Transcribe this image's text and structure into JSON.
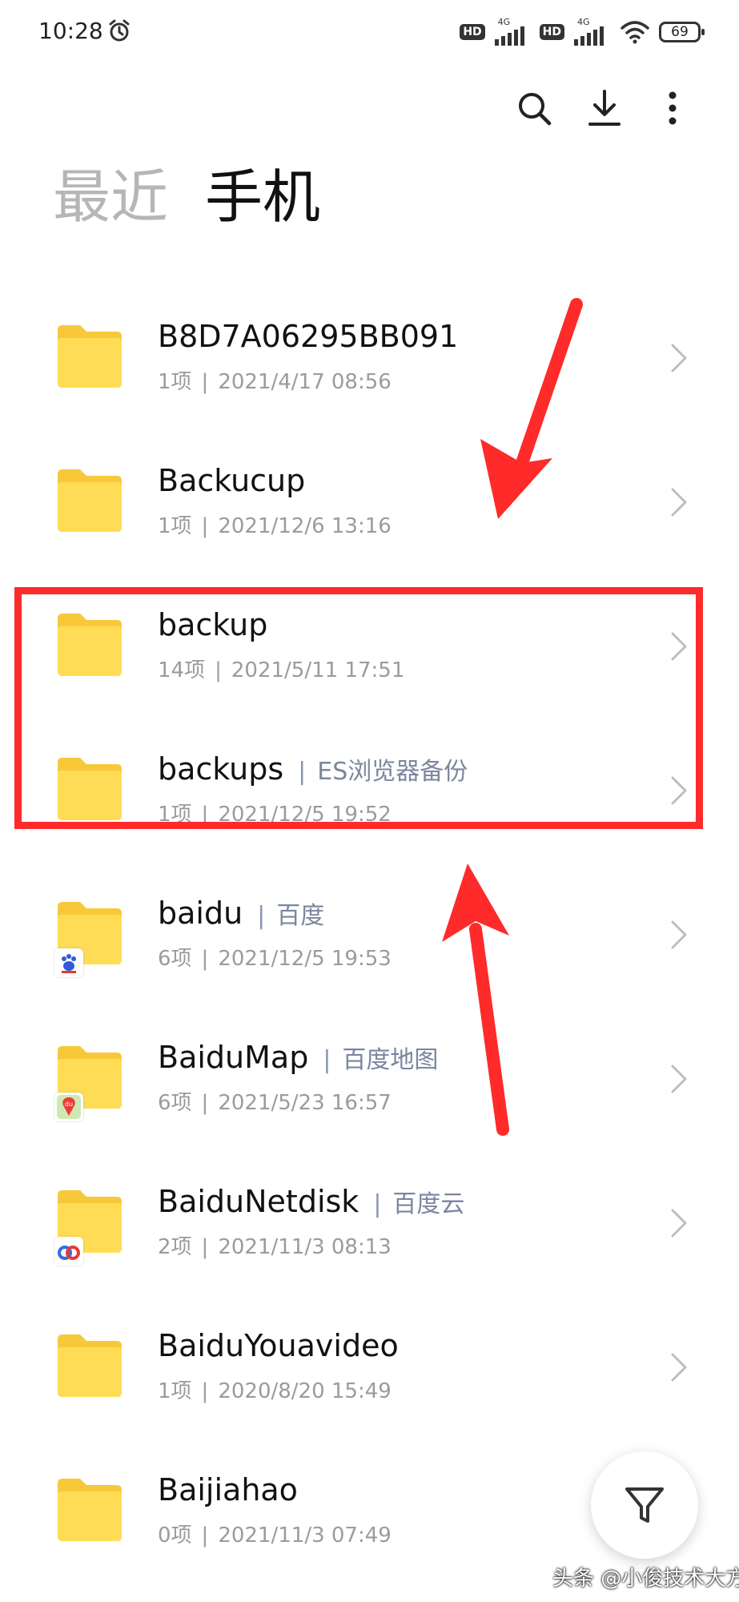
{
  "status_bar": {
    "time": "10:28",
    "hd_label": "HD",
    "network_label": "4G",
    "battery": "69"
  },
  "toolbar": {
    "icons": [
      "search-icon",
      "download-icon",
      "more-icon"
    ]
  },
  "tabs": [
    {
      "label": "最近",
      "active": false
    },
    {
      "label": "手机",
      "active": true
    }
  ],
  "folders": [
    {
      "name": "B8D7A06295BB091",
      "alias": "",
      "count": "1项",
      "date": "2021/4/17 08:56",
      "badge": ""
    },
    {
      "name": "Backucup",
      "alias": "",
      "count": "1项",
      "date": "2021/12/6 13:16",
      "badge": ""
    },
    {
      "name": "backup",
      "alias": "",
      "count": "14项",
      "date": "2021/5/11 17:51",
      "badge": ""
    },
    {
      "name": "backups",
      "alias": "ES浏览器备份",
      "count": "1项",
      "date": "2021/12/5 19:52",
      "badge": ""
    },
    {
      "name": "baidu",
      "alias": "百度",
      "count": "6项",
      "date": "2021/12/5 19:53",
      "badge": "baidu-paw-icon"
    },
    {
      "name": "BaiduMap",
      "alias": "百度地图",
      "count": "6项",
      "date": "2021/5/23 16:57",
      "badge": "baidu-map-icon"
    },
    {
      "name": "BaiduNetdisk",
      "alias": "百度云",
      "count": "2项",
      "date": "2021/11/3 08:13",
      "badge": "baidu-netdisk-icon"
    },
    {
      "name": "BaiduYouavideo",
      "alias": "",
      "count": "1项",
      "date": "2020/8/20 15:49",
      "badge": ""
    },
    {
      "name": "Baijiahao",
      "alias": "",
      "count": "0项",
      "date": "2021/11/3 07:49",
      "badge": ""
    }
  ],
  "separator": "|",
  "badge_texts": {
    "map": "du"
  },
  "fab": {
    "icon": "filter-icon"
  },
  "watermark": "头条 @小俊技术大方",
  "colors": {
    "annotation_red": "#ff2a2a",
    "folder_yellow": "#ffd84a",
    "alias_gray": "#7b869f"
  }
}
